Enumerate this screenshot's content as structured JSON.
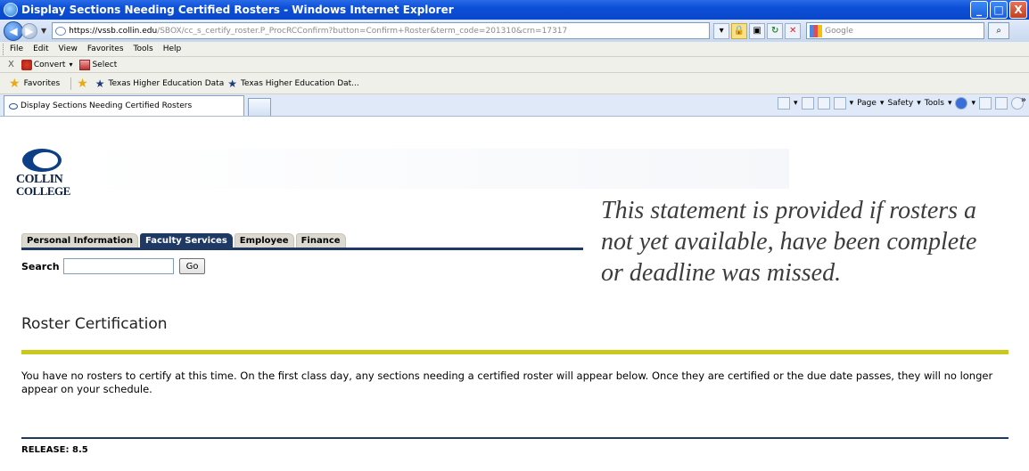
{
  "window": {
    "title": "Display Sections Needing Certified Rosters - Windows Internet Explorer",
    "min_label": "_",
    "max_label": "□",
    "close_label": "X"
  },
  "address": {
    "scheme": "https://",
    "host": "vssb.collin.edu",
    "path": "/SBOX/cc_s_certify_roster.P_ProcRCConfirm?button=Confirm+Roster&term_code=201310&crn=17317",
    "search_placeholder": "Google"
  },
  "menu": [
    "File",
    "Edit",
    "View",
    "Favorites",
    "Tools",
    "Help"
  ],
  "toolbar": {
    "close_label": "X",
    "convert_label": "Convert",
    "select_label": "Select"
  },
  "favorites": {
    "label": "Favorites",
    "links": [
      "Texas Higher Education Data",
      "Texas Higher Education Dat..."
    ]
  },
  "browser_tab": {
    "label": "Display Sections Needing Certified Rosters"
  },
  "commands": {
    "page": "Page",
    "safety": "Safety",
    "tools": "Tools",
    "overflow": "»"
  },
  "logo": {
    "line1": "COLLIN",
    "line2": "COLLEGE"
  },
  "nav_tabs": [
    {
      "label": "Personal Information",
      "active": false
    },
    {
      "label": "Faculty Services",
      "active": true
    },
    {
      "label": "Employee",
      "active": false
    },
    {
      "label": "Finance",
      "active": false
    }
  ],
  "search": {
    "label": "Search",
    "go_label": "Go"
  },
  "annotation": {
    "line1": "This statement is provided if rosters a",
    "line2": "not yet available, have been complete",
    "line3": "or deadline was missed."
  },
  "page": {
    "title": "Roster Certification",
    "message": "You have no rosters to certify at this time. On the first class day, any sections needing a certified roster will appear below. Once they are certified or the due date passes, they will no longer appear on your schedule.",
    "release": "RELEASE: 8.5"
  },
  "colors": {
    "nav_active": "#1e3a64",
    "yellow_rule": "#c8c81e",
    "title_bar": "#0b4fd8"
  }
}
